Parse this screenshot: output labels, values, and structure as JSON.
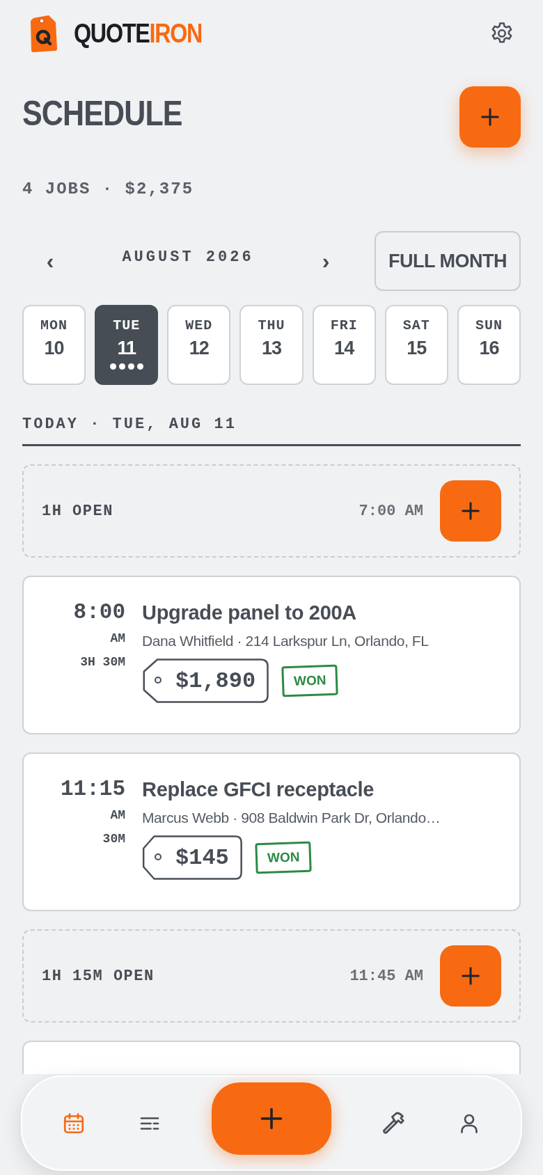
{
  "app": {
    "brand_first": "QUOTE",
    "brand_second": "IRON"
  },
  "header": {
    "title": "SCHEDULE",
    "summary": "4 JOBS · $2,375"
  },
  "month_nav": {
    "prev": "‹",
    "label": "AUGUST 2026",
    "next": "›",
    "full_month": "FULL MONTH"
  },
  "days": [
    {
      "weekday": "MON",
      "date": "10",
      "selected": false,
      "has_jobs": false
    },
    {
      "weekday": "TUE",
      "date": "11",
      "selected": true,
      "has_jobs": true
    },
    {
      "weekday": "WED",
      "date": "12",
      "selected": false,
      "has_jobs": false
    },
    {
      "weekday": "THU",
      "date": "13",
      "selected": false,
      "has_jobs": false
    },
    {
      "weekday": "FRI",
      "date": "14",
      "selected": false,
      "has_jobs": false
    },
    {
      "weekday": "SAT",
      "date": "15",
      "selected": false,
      "has_jobs": false
    },
    {
      "weekday": "SUN",
      "date": "16",
      "selected": false,
      "has_jobs": false
    }
  ],
  "day_heading": "TODAY · TUE, AUG 11",
  "agenda": [
    {
      "kind": "open",
      "label": "1H OPEN",
      "time": "7:00 AM"
    },
    {
      "kind": "job",
      "time": "8:00",
      "ampm": "AM",
      "duration": "3H 30M",
      "title": "Upgrade panel to 200A",
      "detail": "Dana Whitfield · 214 Larkspur Ln, Orlando, FL",
      "price": "$1,890",
      "status": "WON"
    },
    {
      "kind": "job",
      "time": "11:15",
      "ampm": "AM",
      "duration": "30M",
      "title": "Replace GFCI receptacle",
      "detail": "Marcus Webb · 908 Baldwin Park Dr, Orlando…",
      "price": "$145",
      "status": "WON"
    },
    {
      "kind": "open",
      "label": "1H 15M OPEN",
      "time": "11:45 AM"
    },
    {
      "kind": "job_peek"
    }
  ],
  "bottom_nav": [
    {
      "kind": "calendar",
      "selected": true
    },
    {
      "kind": "list",
      "selected": false
    },
    {
      "kind": "add"
    },
    {
      "kind": "hammer",
      "selected": false
    },
    {
      "kind": "person",
      "selected": false
    }
  ]
}
